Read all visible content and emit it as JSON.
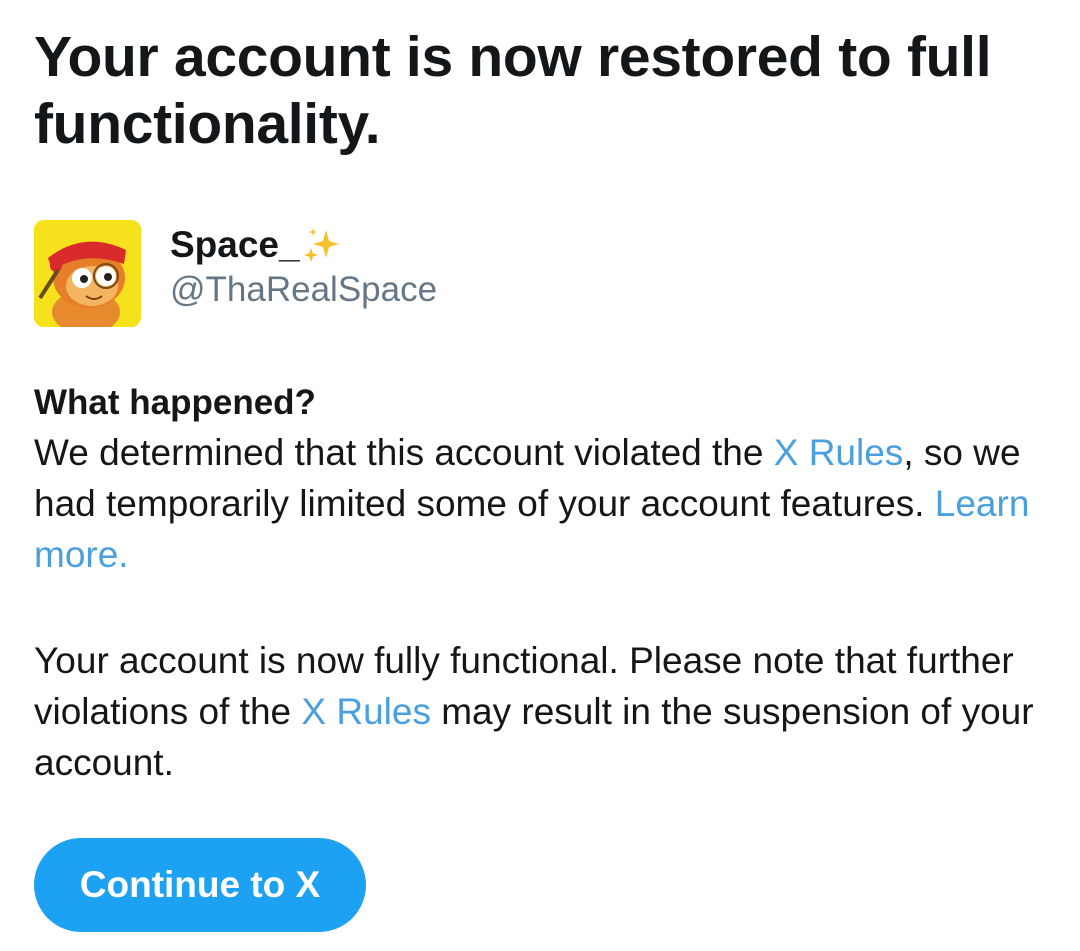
{
  "headline": "Your account is now restored to full functionality.",
  "account": {
    "display_name": "Space_",
    "display_name_icon": "sparkles-icon",
    "handle": "@ThaRealSpace",
    "avatar_icon": "cartoon-monkey-avatar"
  },
  "what_happened": {
    "title": "What happened?",
    "text_before_link": "We determined that this account violated the ",
    "rules_link": "X Rules",
    "text_after_link": ", so we had temporarily limited some of your account features. ",
    "learn_more_link": "Learn more."
  },
  "status": {
    "text_before_link": "Your account is now fully functional. Please note that further violations of the ",
    "rules_link": "X Rules",
    "text_after_link": " may result in the suspension of your account."
  },
  "button": {
    "continue_label": "Continue to X"
  },
  "colors": {
    "link": "#4aa0de",
    "button": "#1da1f2",
    "text": "#14171a",
    "handle": "#657786"
  }
}
